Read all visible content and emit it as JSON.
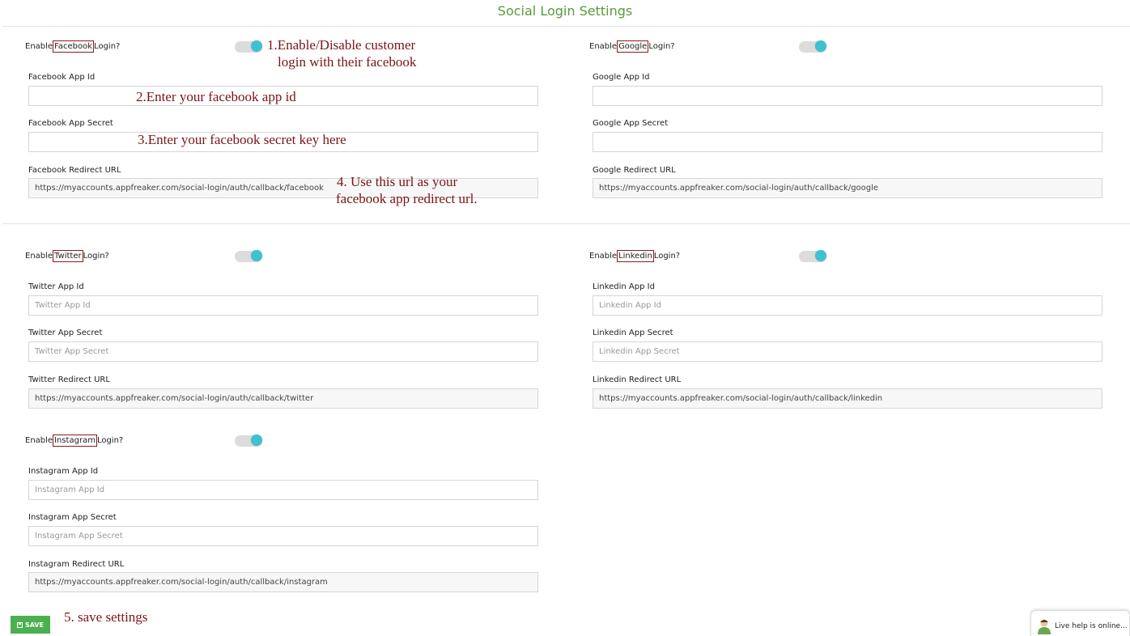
{
  "page_title": "Social Login Settings",
  "enable_prefix": "Enable",
  "enable_suffix": "Login?",
  "providers": {
    "facebook": {
      "name": "Facebook",
      "enabled": true,
      "app_id_label": "Facebook App Id",
      "app_id_value": "",
      "app_secret_label": "Facebook App Secret",
      "app_secret_value": "",
      "redirect_label": "Facebook Redirect URL",
      "redirect_value": "https://myaccounts.appfreaker.com/social-login/auth/callback/facebook"
    },
    "google": {
      "name": "Google",
      "enabled": true,
      "app_id_label": "Google App Id",
      "app_id_value": "",
      "app_secret_label": "Google App Secret",
      "app_secret_value": "",
      "redirect_label": "Google Redirect URL",
      "redirect_value": "https://myaccounts.appfreaker.com/social-login/auth/callback/google"
    },
    "twitter": {
      "name": "Twitter",
      "enabled": true,
      "app_id_label": "Twitter App Id",
      "app_id_placeholder": "Twitter App Id",
      "app_secret_label": "Twitter App Secret",
      "app_secret_placeholder": "Twitter App Secret",
      "redirect_label": "Twitter Redirect URL",
      "redirect_value": "https://myaccounts.appfreaker.com/social-login/auth/callback/twitter"
    },
    "linkedin": {
      "name": "Linkedin",
      "enabled": true,
      "app_id_label": "Linkedin App Id",
      "app_id_placeholder": "Linkedin App Id",
      "app_secret_label": "Linkedin App Secret",
      "app_secret_placeholder": "Linkedin App Secret",
      "redirect_label": "Linkedin Redirect URL",
      "redirect_value": "https://myaccounts.appfreaker.com/social-login/auth/callback/linkedin"
    },
    "instagram": {
      "name": "Instagram",
      "enabled": true,
      "app_id_label": "Instagram App Id",
      "app_id_placeholder": "Instagram App Id",
      "app_secret_label": "Instagram App Secret",
      "app_secret_placeholder": "Instagram App Secret",
      "redirect_label": "Instagram Redirect URL",
      "redirect_value": "https://myaccounts.appfreaker.com/social-login/auth/callback/instagram"
    }
  },
  "annotations": {
    "a1_line1": "1.Enable/Disable customer",
    "a1_line2": "login with their facebook",
    "a2": "2.Enter your facebook app id",
    "a3": "3.Enter your facebook secret key here",
    "a4_line1": "4. Use this url as your",
    "a4_line2": "facebook  app redirect url.",
    "a5": "5. save settings"
  },
  "save_button": {
    "label": "SAVE",
    "icon": "floppy-disk-icon"
  },
  "live_help": {
    "text": "Live help is online...",
    "icon": "support-agent-icon"
  },
  "colors": {
    "title": "#5a9a3a",
    "toggle_knob": "#3ec1d3",
    "annotation": "#7b1416",
    "save_button": "#4caf50",
    "label_box_border": "#8b1a1a"
  }
}
